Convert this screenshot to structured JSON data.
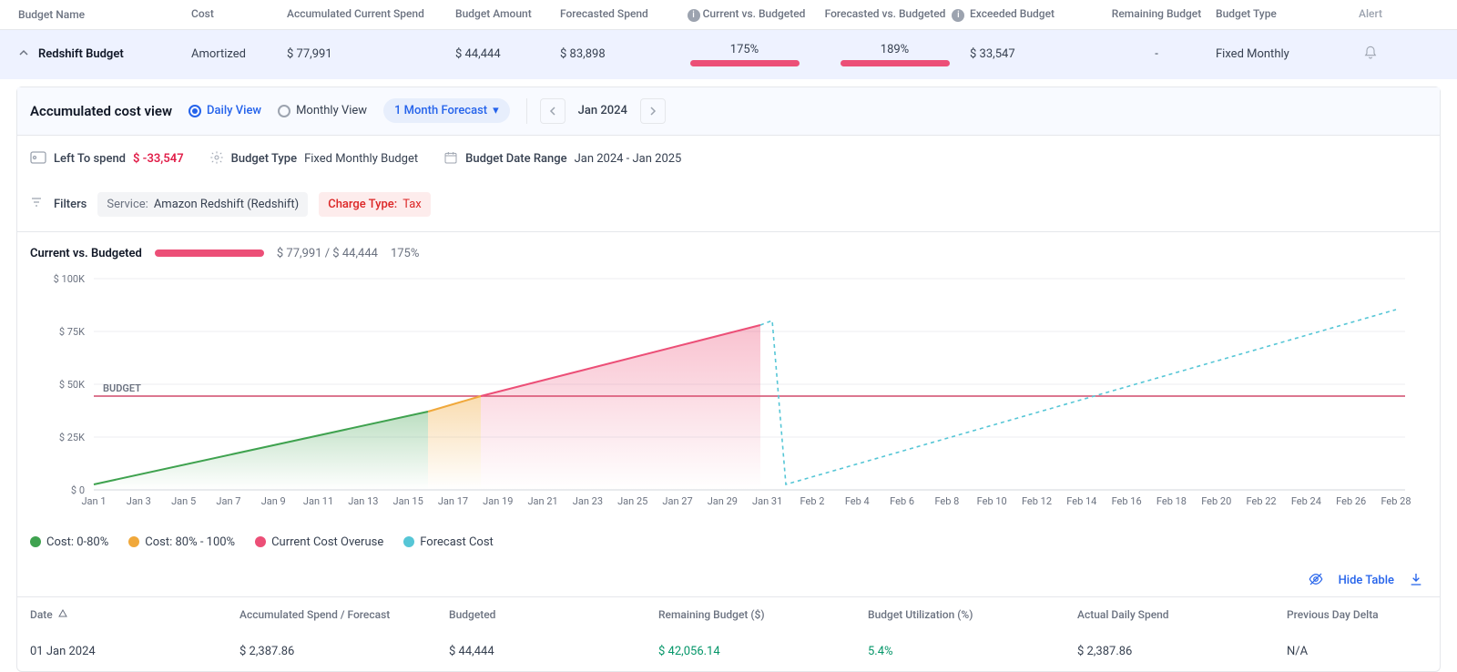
{
  "headers": {
    "name": "Budget Name",
    "cost": "Cost",
    "acc": "Accumulated Current Spend",
    "budget": "Budget Amount",
    "forecasted": "Forecasted Spend",
    "cvb": "Current vs. Budgeted",
    "fvb": "Forecasted vs. Budgeted",
    "exceeded": "Exceeded Budget",
    "remaining": "Remaining Budget",
    "type": "Budget Type",
    "alert": "Alert"
  },
  "row": {
    "name": "Redshift Budget",
    "cost": "Amortized",
    "acc": "$ 77,991",
    "budget": "$ 44,444",
    "forecasted": "$ 83,898",
    "cvb": "175%",
    "fvb": "189%",
    "exceeded": "$ 33,547",
    "remaining": "-",
    "type": "Fixed Monthly"
  },
  "panel": {
    "title": "Accumulated cost view",
    "daily": "Daily View",
    "monthly": "Monthly View",
    "forecast": "1 Month Forecast",
    "period": "Jan 2024"
  },
  "meta": {
    "left_label": "Left To spend",
    "left_value": "$ -33,547",
    "type_label": "Budget Type",
    "type_value": "Fixed Monthly Budget",
    "range_label": "Budget Date Range",
    "range_value": "Jan 2024 - Jan 2025"
  },
  "filters": {
    "label": "Filters",
    "service_key": "Service:",
    "service_val": "Amazon Redshift (Redshift)",
    "charge_key": "Charge Type:",
    "charge_val": "Tax"
  },
  "cvb_section": {
    "title": "Current vs. Budgeted",
    "values": "$ 77,991 / $ 44,444",
    "pct": "175%"
  },
  "legend": {
    "l1": "Cost: 0-80%",
    "l2": "Cost: 80% - 100%",
    "l3": "Current Cost Overuse",
    "l4": "Forecast Cost"
  },
  "hide_table": "Hide Table",
  "dtable": {
    "headers": {
      "date": "Date",
      "acc": "Accumulated Spend / Forecast",
      "budgeted": "Budgeted",
      "remaining": "Remaining Budget ($)",
      "util": "Budget Utilization (%)",
      "actual": "Actual Daily Spend",
      "delta": "Previous Day Delta"
    },
    "row0": {
      "date": "01 Jan 2024",
      "acc": "$ 2,387.86",
      "budgeted": "$ 44,444",
      "remaining": "$ 42,056.14",
      "util": "5.4%",
      "actual": "$ 2,387.86",
      "delta": "N/A"
    }
  },
  "chart_data": {
    "type": "area",
    "title": "Accumulated cost view",
    "xlabel": "",
    "ylabel": "",
    "ylim": [
      0,
      100000
    ],
    "y_ticks": [
      "$ 0",
      "$ 25K",
      "$ 50K",
      "$ 75K",
      "$ 100K"
    ],
    "x_ticks": [
      "Jan 1",
      "Jan 3",
      "Jan 5",
      "Jan 7",
      "Jan 9",
      "Jan 11",
      "Jan 13",
      "Jan 15",
      "Jan 17",
      "Jan 19",
      "Jan 21",
      "Jan 23",
      "Jan 25",
      "Jan 27",
      "Jan 29",
      "Jan 31",
      "Feb 2",
      "Feb 4",
      "Feb 6",
      "Feb 8",
      "Feb 10",
      "Feb 12",
      "Feb 14",
      "Feb 16",
      "Feb 18",
      "Feb 20",
      "Feb 22",
      "Feb 24",
      "Feb 26",
      "Feb 28"
    ],
    "budget_line": 44444,
    "budget_label": "BUDGET",
    "series": [
      {
        "name": "Cost: 0-80%",
        "color": "#3fa24f",
        "x_range": [
          "Jan 1",
          "Jan 15"
        ],
        "y_range": [
          2388,
          37000
        ]
      },
      {
        "name": "Cost: 80% - 100%",
        "color": "#f0a83b",
        "x_range": [
          "Jan 15",
          "Jan 18"
        ],
        "y_range": [
          37000,
          44444
        ]
      },
      {
        "name": "Current Cost Overuse",
        "color": "#ec4f77",
        "x_range": [
          "Jan 18",
          "Jan 31"
        ],
        "y_range": [
          44444,
          77991
        ]
      },
      {
        "name": "Forecast Cost",
        "color": "#56c6d6",
        "dashed": true,
        "points": [
          [
            "Jan 31",
            80000
          ],
          [
            "Feb 1",
            2400
          ],
          [
            "Feb 28",
            85000
          ]
        ]
      }
    ]
  }
}
